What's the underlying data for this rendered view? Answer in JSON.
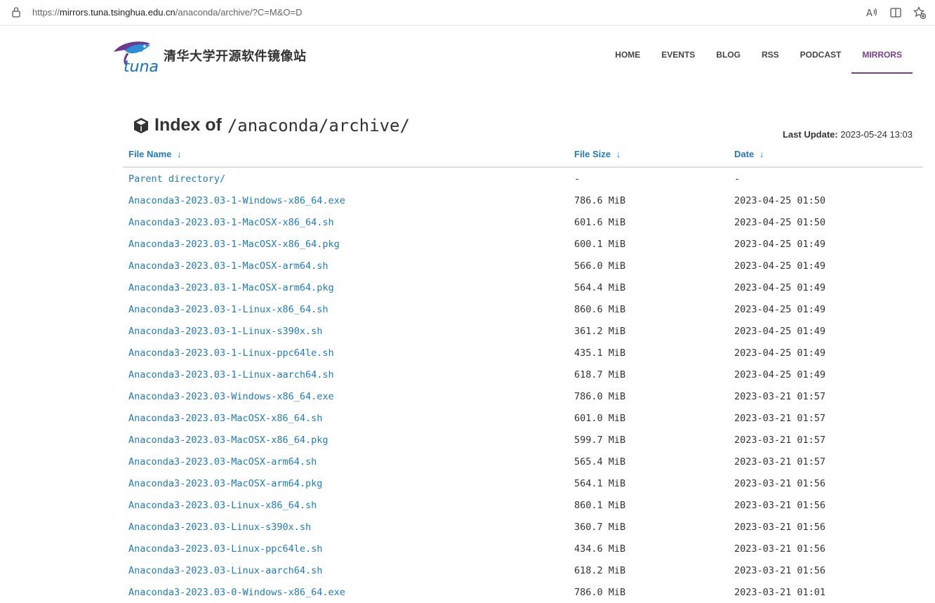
{
  "browser": {
    "url_scheme": "https://",
    "url_host": "mirrors.tuna.tsinghua.edu.cn",
    "url_path": "/anaconda/archive/?C=M&O=D"
  },
  "site": {
    "logo_text": "tuna",
    "title": "清华大学开源软件镜像站"
  },
  "nav": [
    {
      "label": "HOME",
      "active": false
    },
    {
      "label": "EVENTS",
      "active": false
    },
    {
      "label": "BLOG",
      "active": false
    },
    {
      "label": "RSS",
      "active": false
    },
    {
      "label": "PODCAST",
      "active": false
    },
    {
      "label": "MIRRORS",
      "active": true
    }
  ],
  "index": {
    "title_prefix": "Index of",
    "path": "/anaconda/archive/",
    "last_update_label": "Last Update:",
    "last_update_value": "2023-05-24 13:03"
  },
  "table": {
    "headers": {
      "name": "File Name",
      "size": "File Size",
      "date": "Date",
      "arrow": "↓"
    },
    "rows": [
      {
        "name": "Parent directory/",
        "size": "-",
        "date": "-"
      },
      {
        "name": "Anaconda3-2023.03-1-Windows-x86_64.exe",
        "size": "786.6 MiB",
        "date": "2023-04-25 01:50"
      },
      {
        "name": "Anaconda3-2023.03-1-MacOSX-x86_64.sh",
        "size": "601.6 MiB",
        "date": "2023-04-25 01:50"
      },
      {
        "name": "Anaconda3-2023.03-1-MacOSX-x86_64.pkg",
        "size": "600.1 MiB",
        "date": "2023-04-25 01:49"
      },
      {
        "name": "Anaconda3-2023.03-1-MacOSX-arm64.sh",
        "size": "566.0 MiB",
        "date": "2023-04-25 01:49"
      },
      {
        "name": "Anaconda3-2023.03-1-MacOSX-arm64.pkg",
        "size": "564.4 MiB",
        "date": "2023-04-25 01:49"
      },
      {
        "name": "Anaconda3-2023.03-1-Linux-x86_64.sh",
        "size": "860.6 MiB",
        "date": "2023-04-25 01:49"
      },
      {
        "name": "Anaconda3-2023.03-1-Linux-s390x.sh",
        "size": "361.2 MiB",
        "date": "2023-04-25 01:49"
      },
      {
        "name": "Anaconda3-2023.03-1-Linux-ppc64le.sh",
        "size": "435.1 MiB",
        "date": "2023-04-25 01:49"
      },
      {
        "name": "Anaconda3-2023.03-1-Linux-aarch64.sh",
        "size": "618.7 MiB",
        "date": "2023-04-25 01:49"
      },
      {
        "name": "Anaconda3-2023.03-Windows-x86_64.exe",
        "size": "786.0 MiB",
        "date": "2023-03-21 01:57"
      },
      {
        "name": "Anaconda3-2023.03-MacOSX-x86_64.sh",
        "size": "601.0 MiB",
        "date": "2023-03-21 01:57"
      },
      {
        "name": "Anaconda3-2023.03-MacOSX-x86_64.pkg",
        "size": "599.7 MiB",
        "date": "2023-03-21 01:57"
      },
      {
        "name": "Anaconda3-2023.03-MacOSX-arm64.sh",
        "size": "565.4 MiB",
        "date": "2023-03-21 01:57"
      },
      {
        "name": "Anaconda3-2023.03-MacOSX-arm64.pkg",
        "size": "564.1 MiB",
        "date": "2023-03-21 01:56"
      },
      {
        "name": "Anaconda3-2023.03-Linux-x86_64.sh",
        "size": "860.1 MiB",
        "date": "2023-03-21 01:56"
      },
      {
        "name": "Anaconda3-2023.03-Linux-s390x.sh",
        "size": "360.7 MiB",
        "date": "2023-03-21 01:56"
      },
      {
        "name": "Anaconda3-2023.03-Linux-ppc64le.sh",
        "size": "434.6 MiB",
        "date": "2023-03-21 01:56"
      },
      {
        "name": "Anaconda3-2023.03-Linux-aarch64.sh",
        "size": "618.2 MiB",
        "date": "2023-03-21 01:56"
      },
      {
        "name": "Anaconda3-2023.03-0-Windows-x86_64.exe",
        "size": "786.0 MiB",
        "date": "2023-03-21 01:01"
      }
    ]
  },
  "colors": {
    "link": "#1f7bb8",
    "nav_active": "#7a3e8f"
  }
}
